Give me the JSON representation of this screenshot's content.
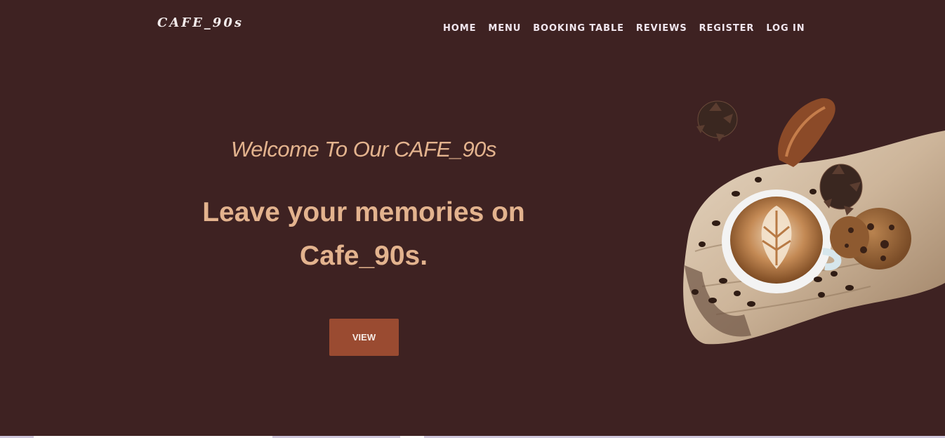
{
  "header": {
    "logo": "CAFE_90s",
    "nav": [
      "HOME",
      "MENU",
      "BOOKING TABLE",
      "REVIEWS",
      "REGISTER",
      "LOG IN"
    ]
  },
  "hero": {
    "welcome": "Welcome To Our CAFE_90s",
    "headline_line1": "Leave your memories on",
    "headline_line2": "Cafe_90s.",
    "button_label": "VIEW",
    "image_icon": "coffee-cup-on-wood-board-image"
  },
  "colors": {
    "background": "#3e2222",
    "accent_text": "#e3b38e",
    "button": "#9a4b31",
    "nav_text": "#f0e6ee"
  }
}
